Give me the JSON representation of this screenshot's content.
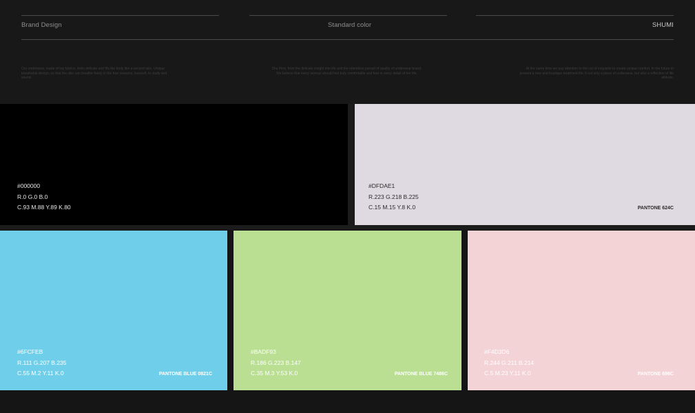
{
  "header": {
    "brand_label": "Brand Design",
    "section_label": "Standard color",
    "logo_text": "SHUMI",
    "blurb_left": "Our underwear, made of top fabrics, feels delicate and fits the body like a second skin. Unique breathable design, so that the skin can breathe freely in the four seasons, lovesoft, to study and sound.",
    "blurb_center": "Shu Pind, from the delicate insight into life and the relentless pursuit of quality of underwear brand. We believe that every woman should feel truly comfortable and free in every detail of her life.",
    "blurb_right": "At the same time we pay attention to the cut of exquisite to create unique comfort. In the future to present a new and boutique treatment life, it not only a piece of underwear, but also a reflection of life attitude."
  },
  "swatches": [
    {
      "hex": "#000000",
      "rgb": "R.0  G.0  B.0",
      "cmyk": "C.93  M.88  Y.89  K.80",
      "pantone": "",
      "color": "#000000",
      "text_color": "#e6e6e6"
    },
    {
      "hex": "#DFDAE1",
      "rgb": "R.223  G.218  B.225",
      "cmyk": "C.15  M.15  Y.8  K.0",
      "pantone": "PANTONE 624C",
      "color": "#DFDAE1",
      "text_color": "#2a2a2a"
    },
    {
      "hex": "#6FCFEB",
      "rgb": "R.111  G.207  B.235",
      "cmyk": "C.55  M.2  Y.11  K.0",
      "pantone": "PANTONE BLUE 0821C",
      "color": "#6FCFEB",
      "text_color": "#ffffff"
    },
    {
      "hex": "#BADF93",
      "rgb": "R.186  G.223  B.147",
      "cmyk": "C.35  M.3  Y.53  K.0",
      "pantone": "PANTONE BLUE 7486C",
      "color": "#BADF93",
      "text_color": "#ffffff"
    },
    {
      "hex": "#F4D3D6",
      "rgb": "R.244  G.211  B.214",
      "cmyk": "C.5  M.23  Y.11  K.0",
      "pantone": "PANTONE 698C",
      "color": "#F4D3D6",
      "text_color": "#ffffff"
    }
  ]
}
